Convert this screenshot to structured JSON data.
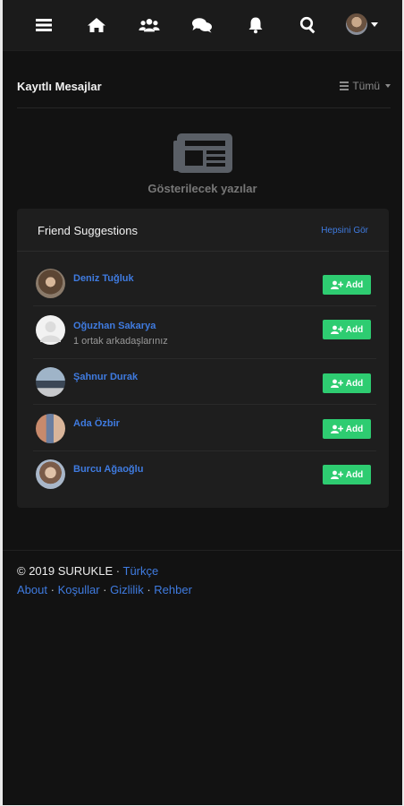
{
  "nav": {
    "items": [
      "menu-icon",
      "home-icon",
      "groups-icon",
      "messages-icon",
      "bell-icon",
      "search-icon",
      "avatar"
    ]
  },
  "saved": {
    "title": "Kayıtlı Mesajlar",
    "filter_label": "Tümü"
  },
  "empty_state": {
    "icon": "newspaper-icon",
    "text": "Gösterilecek yazılar"
  },
  "suggestions": {
    "title": "Friend Suggestions",
    "see_all": "Hepsini Gör",
    "add_label": "Add",
    "people": [
      {
        "name": "Deniz Tuğluk",
        "sub": ""
      },
      {
        "name": "Oğuzhan Sakarya",
        "sub": "1 ortak arkadaşlarınız"
      },
      {
        "name": "Şahnur Durak",
        "sub": ""
      },
      {
        "name": "Ada Özbir",
        "sub": ""
      },
      {
        "name": "Burcu Ağaoğlu",
        "sub": ""
      }
    ]
  },
  "footer": {
    "copyright": "© 2019 SURUKLE",
    "language": "Türkçe",
    "links": [
      "About",
      "Koşullar",
      "Gizlilik",
      "Rehber"
    ]
  },
  "colors": {
    "background": "#121212",
    "link": "#3f7be0",
    "add_button": "#2ecc71"
  }
}
